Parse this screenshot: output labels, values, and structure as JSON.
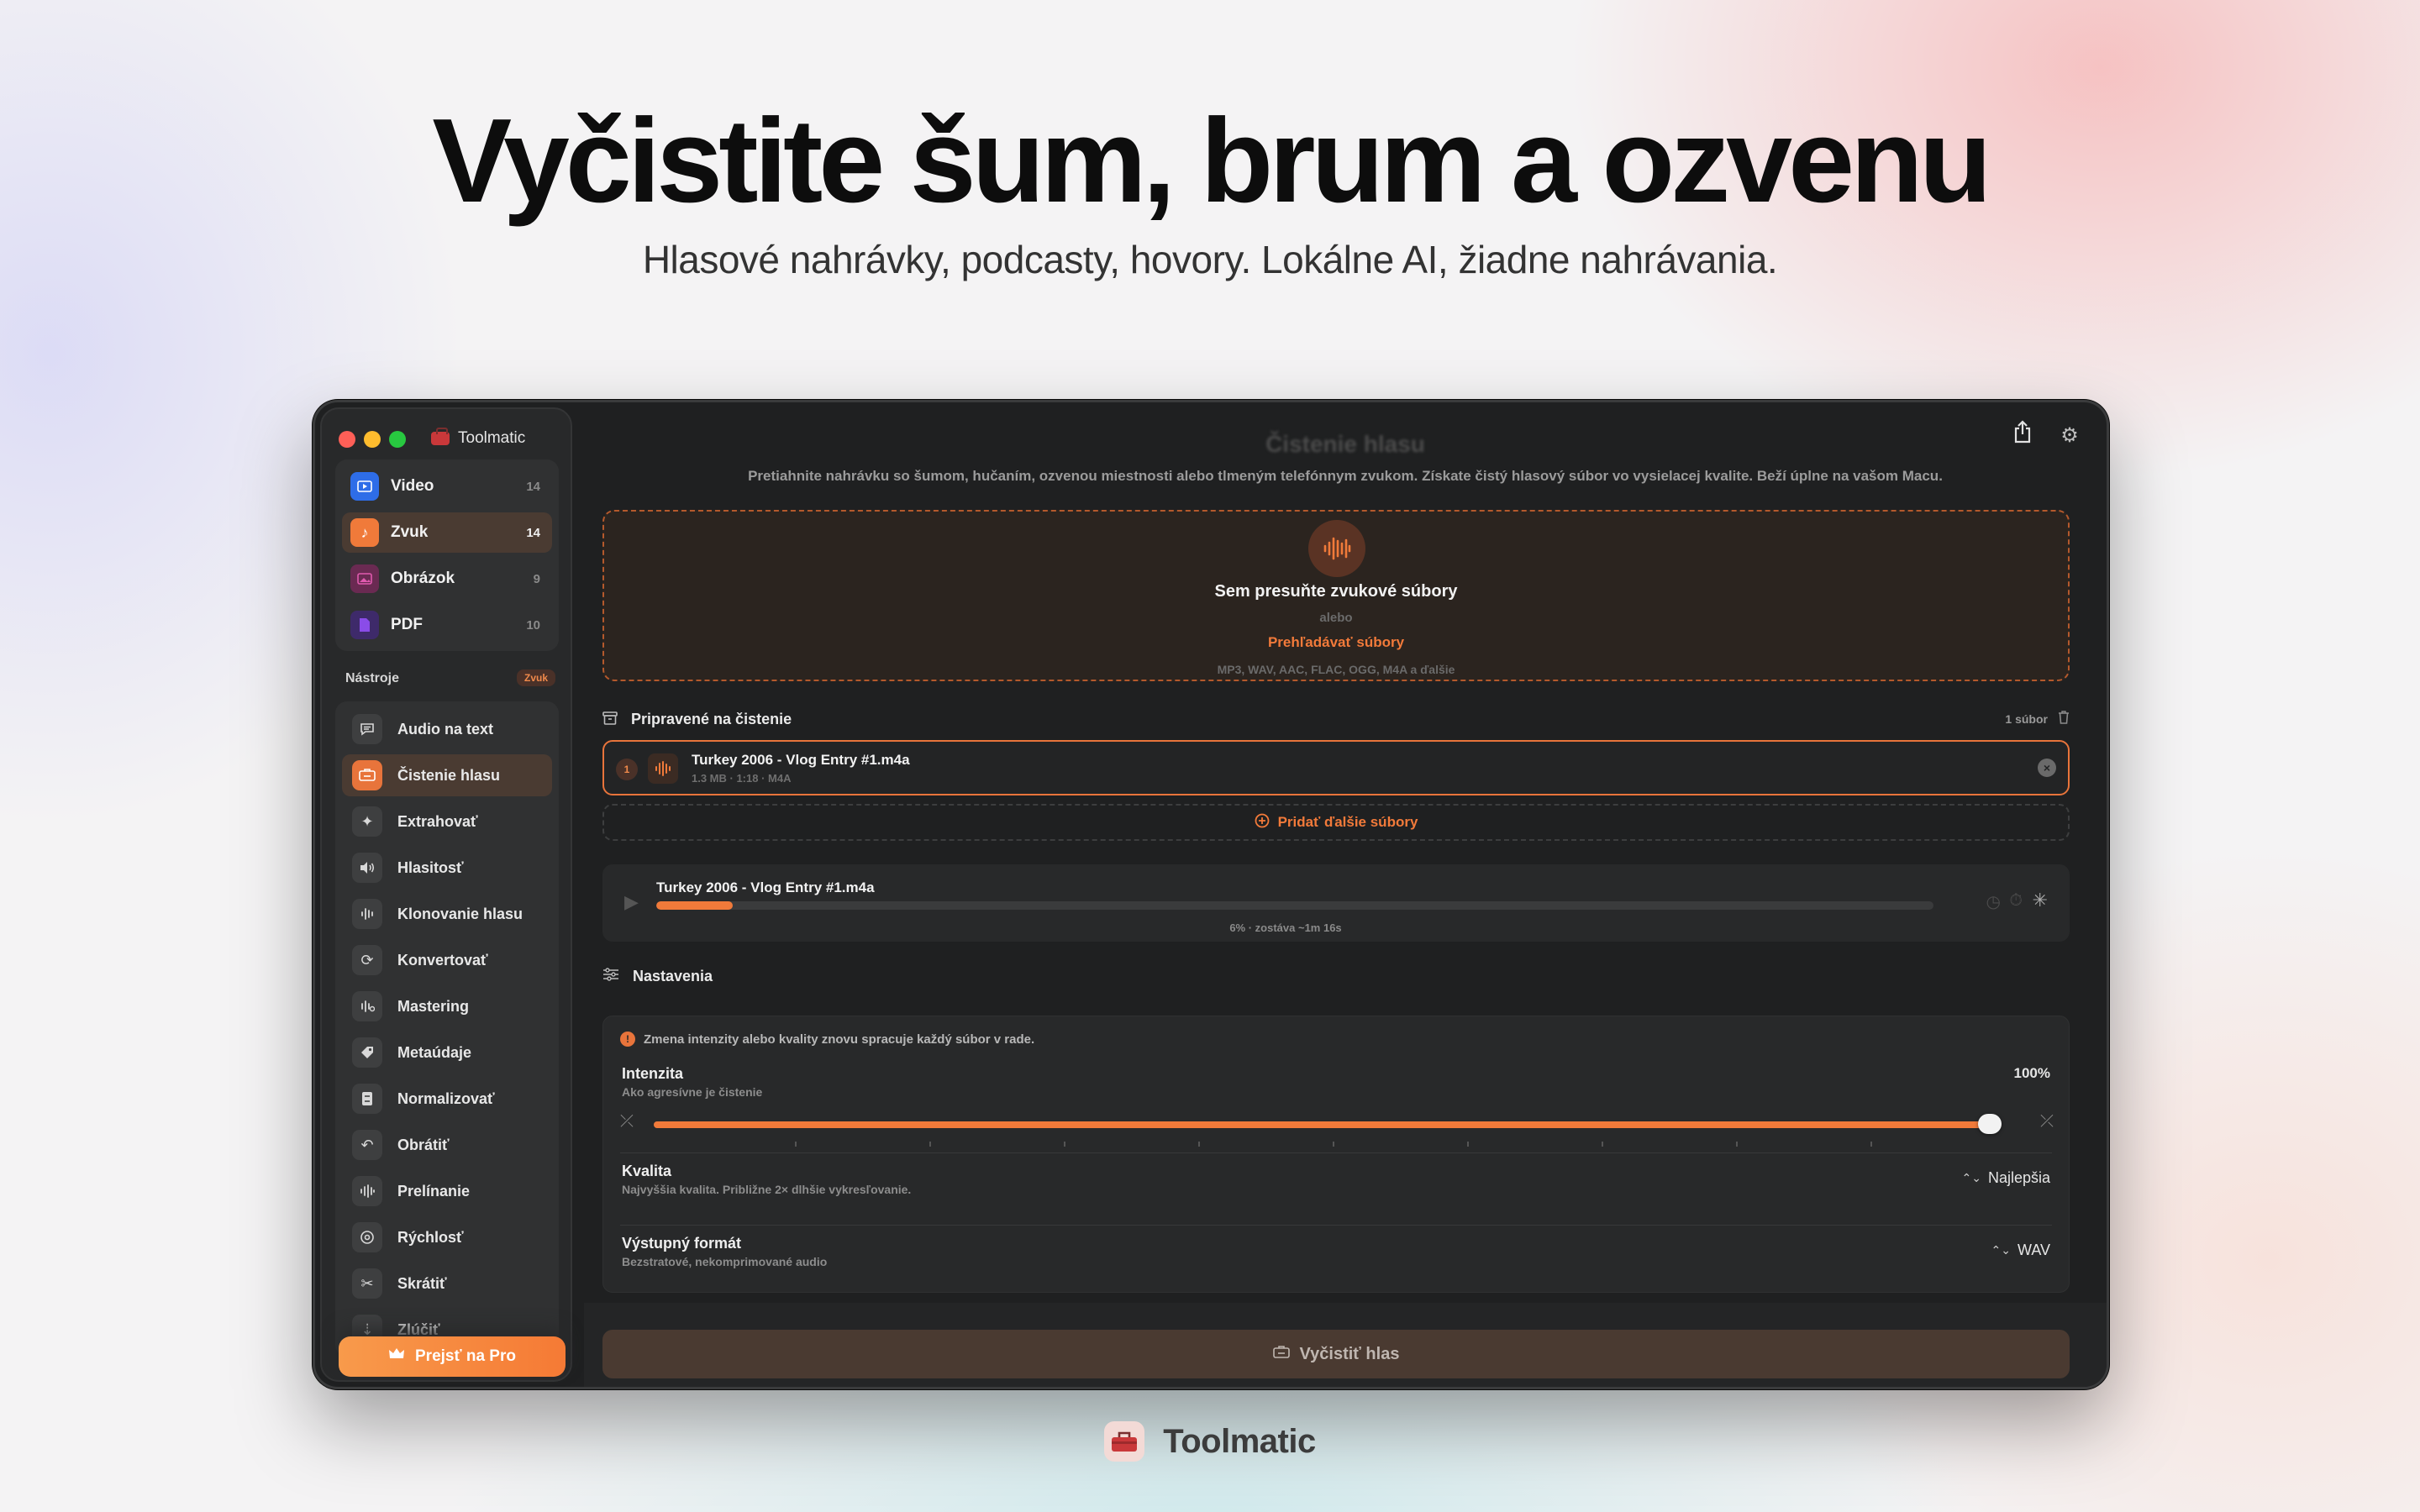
{
  "hero": {
    "headline": "Vyčistite šum, brum a ozvenu",
    "subline": "Hlasové nahrávky, podcasty, hovory. Lokálne AI, žiadne nahrávania."
  },
  "window": {
    "app_title": "Toolmatic",
    "main_title": "Čistenie hlasu",
    "main_description": "Pretiahnite nahrávku so šumom, hučaním, ozvenou miestnosti alebo tlmeným telefónnym zvukom. Získate čistý hlasový súbor vo vysielacej kvalite. Beží úplne na vašom Macu."
  },
  "sidebar": {
    "categories": [
      {
        "label": "Video",
        "count": "14",
        "icon": "video-icon",
        "color": "#2e6de8"
      },
      {
        "label": "Zvuk",
        "count": "14",
        "icon": "music-note-icon",
        "color": "#f07a3a"
      },
      {
        "label": "Obrázok",
        "count": "9",
        "icon": "image-icon",
        "color": "#d94aa4"
      },
      {
        "label": "PDF",
        "count": "10",
        "icon": "pdf-icon",
        "color": "#8a4ce8"
      }
    ],
    "tools_heading": "Nástroje",
    "tools_badge": "Zvuk",
    "tools": [
      {
        "label": "Audio na text",
        "icon": "chat-bubble-icon"
      },
      {
        "label": "Čistenie hlasu",
        "icon": "voice-clean-icon"
      },
      {
        "label": "Extrahovať",
        "icon": "sparkle-icon"
      },
      {
        "label": "Hlasitosť",
        "icon": "speaker-icon"
      },
      {
        "label": "Klonovanie hlasu",
        "icon": "waveform-icon"
      },
      {
        "label": "Konvertovať",
        "icon": "refresh-icon"
      },
      {
        "label": "Mastering",
        "icon": "mastering-icon"
      },
      {
        "label": "Metaúdaje",
        "icon": "tag-icon"
      },
      {
        "label": "Normalizovať",
        "icon": "normalize-icon"
      },
      {
        "label": "Obrátiť",
        "icon": "undo-icon"
      },
      {
        "label": "Prelínanie",
        "icon": "crossfade-icon"
      },
      {
        "label": "Rýchlosť",
        "icon": "speed-icon"
      },
      {
        "label": "Skrátiť",
        "icon": "scissors-icon"
      },
      {
        "label": "Zlúčiť",
        "icon": "merge-icon"
      }
    ],
    "upgrade_label": "Prejsť na Pro"
  },
  "dropzone": {
    "title": "Sem presuňte zvukové súbory",
    "or": "alebo",
    "browse": "Prehľadávať súbory",
    "formats": "MP3, WAV, AAC, FLAC, OGG, M4A a ďalšie"
  },
  "queue": {
    "title": "Pripravené na čistenie",
    "count": "1 súbor",
    "file": {
      "index": "1",
      "name": "Turkey 2006 - Vlog Entry #1.m4a",
      "meta": "1.3 MB · 1:18 · M4A"
    },
    "add_more": "Pridať ďalšie súbory"
  },
  "progress": {
    "name": "Turkey 2006 - Vlog Entry #1.m4a",
    "status": "6% · zostáva ~1m 16s",
    "fraction": 0.06
  },
  "settings": {
    "title": "Nastavenia",
    "notice": "Zmena intenzity alebo kvality znovu spracuje každý súbor v rade.",
    "intensity": {
      "label": "Intenzita",
      "sub": "Ako agresívne je čistenie",
      "value": "100%",
      "fraction": 1.0
    },
    "quality": {
      "label": "Kvalita",
      "sub": "Najvyššia kvalita. Približne 2× dlhšie vykresľovanie.",
      "value": "Najlepšia"
    },
    "format": {
      "label": "Výstupný formát",
      "sub": "Bezstratové, nekomprimované audio",
      "value": "WAV"
    }
  },
  "action": {
    "run_label": "Vyčistiť hlas"
  },
  "brand": {
    "name": "Toolmatic"
  },
  "colors": {
    "accent": "#f07a3a",
    "bg_dark": "#1f2021"
  }
}
